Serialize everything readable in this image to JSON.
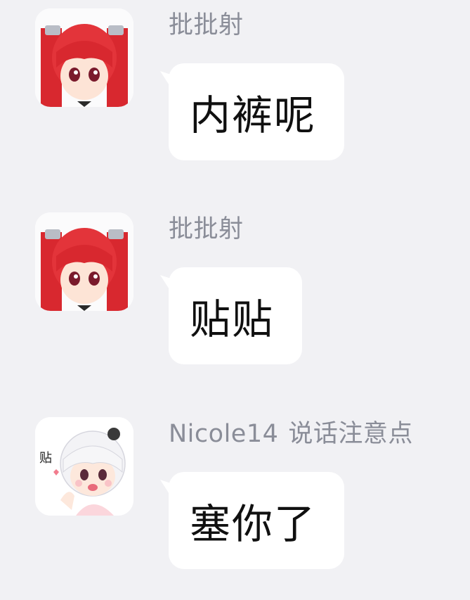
{
  "messages": [
    {
      "sender": "批批射",
      "sender_title": "",
      "text": "内裤呢",
      "avatar_icon": "red-hair-anime-girl-avatar-icon"
    },
    {
      "sender": "批批射",
      "sender_title": "",
      "text": "贴贴",
      "avatar_icon": "red-hair-anime-girl-avatar-icon"
    },
    {
      "sender": "Nicole14",
      "sender_title": "说话注意点",
      "text": "塞你了",
      "avatar_icon": "white-hair-anime-girl-sticker-avatar-icon",
      "avatar_caption": "贴"
    }
  ],
  "colors": {
    "background": "#f1f1f4",
    "bubble": "#ffffff",
    "sender_text": "#8a8d98",
    "message_text": "#101010",
    "hair_red": "#d8282f"
  }
}
